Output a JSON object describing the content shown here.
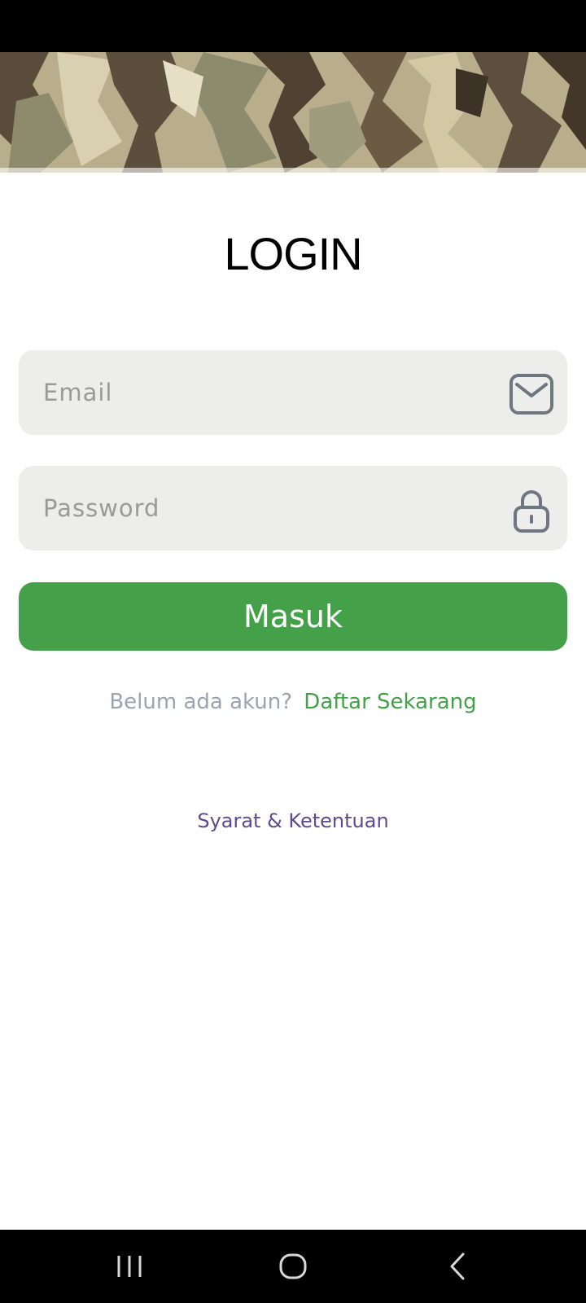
{
  "login": {
    "title": "LOGIN",
    "email_placeholder": "Email",
    "password_placeholder": "Password",
    "submit_label": "Masuk",
    "signup_prompt": "Belum ada akun?",
    "signup_link": "Daftar Sekarang",
    "terms_link": "Syarat & Ketentuan"
  },
  "icons": {
    "email": "envelope-icon",
    "password": "lock-icon",
    "recent_apps": "recent-apps-icon",
    "home": "home-icon",
    "back": "back-icon"
  },
  "colors": {
    "primary": "#44a14a",
    "field_bg": "#ededec",
    "link_secondary": "#5d4b8f",
    "muted_text": "#9aa3b0"
  }
}
